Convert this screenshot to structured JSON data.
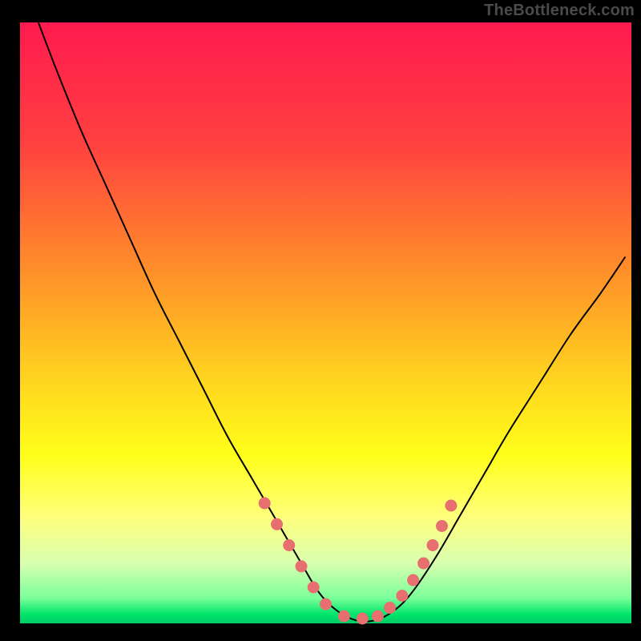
{
  "watermark": "TheBottleneck.com",
  "colors": {
    "frame": "#000000",
    "curve": "#000000",
    "dot": "#e76f6f",
    "gradient_stops": [
      {
        "offset": 0.0,
        "color": "#ff1a4f"
      },
      {
        "offset": 0.2,
        "color": "#ff4040"
      },
      {
        "offset": 0.4,
        "color": "#ff8a2a"
      },
      {
        "offset": 0.58,
        "color": "#ffcf20"
      },
      {
        "offset": 0.72,
        "color": "#ffff1a"
      },
      {
        "offset": 0.82,
        "color": "#ffff7a"
      },
      {
        "offset": 0.9,
        "color": "#d9ffb0"
      },
      {
        "offset": 0.958,
        "color": "#7aff9a"
      },
      {
        "offset": 0.985,
        "color": "#00e56a"
      },
      {
        "offset": 1.0,
        "color": "#00cc66"
      }
    ]
  },
  "chart_data": {
    "type": "line",
    "title": "",
    "xlabel": "",
    "ylabel": "",
    "xlim": [
      0,
      100
    ],
    "ylim": [
      0,
      100
    ],
    "grid": false,
    "annotations": [],
    "series": [
      {
        "name": "bottleneck-curve",
        "x": [
          3,
          6,
          10,
          14,
          18,
          22,
          26,
          30,
          34,
          38,
          42,
          46,
          49,
          52,
          55,
          58,
          61,
          64,
          68,
          72,
          76,
          80,
          85,
          90,
          95,
          99
        ],
        "y": [
          100,
          92,
          82,
          73,
          64,
          55,
          47,
          39,
          31,
          24,
          17,
          10,
          5,
          2,
          0.5,
          0.5,
          2,
          5,
          11,
          18,
          25,
          32,
          40,
          48,
          55,
          61
        ]
      }
    ],
    "markers": {
      "name": "highlight-dots",
      "x": [
        40,
        42,
        44,
        46,
        48,
        50,
        53,
        56,
        58.5,
        60.5,
        62.5,
        64.3,
        66,
        67.5,
        69,
        70.5
      ],
      "y": [
        20,
        16.5,
        13,
        9.5,
        6,
        3.2,
        1.2,
        0.8,
        1.2,
        2.6,
        4.6,
        7.2,
        10,
        13,
        16.2,
        19.6
      ]
    }
  }
}
